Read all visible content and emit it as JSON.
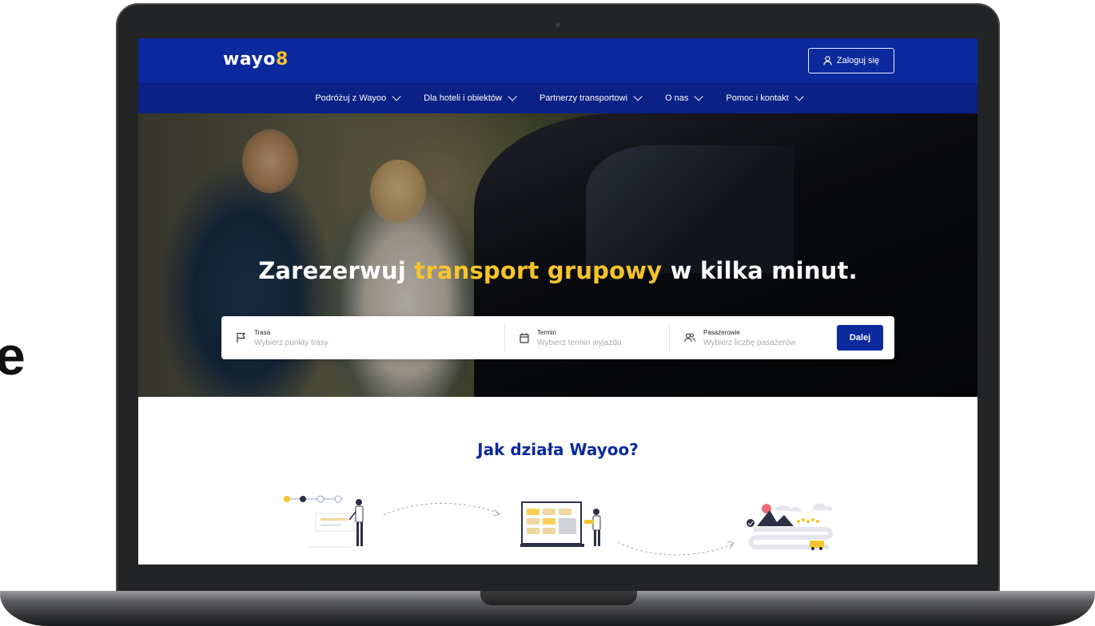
{
  "partial_text": "e",
  "header": {
    "logo_text": "wayo",
    "logo_pin": "8",
    "login_label": "Zaloguj się"
  },
  "nav": {
    "items": [
      {
        "label": "Podróżuj z Wayoo"
      },
      {
        "label": "Dla hoteli i obiektów"
      },
      {
        "label": "Partnerzy transportowi"
      },
      {
        "label": "O nas"
      },
      {
        "label": "Pomoc i kontakt"
      }
    ]
  },
  "hero": {
    "title_before": "Zarezerwuj ",
    "title_accent": "transport grupowy",
    "title_after": " w kilka minut."
  },
  "search": {
    "route_label": "Trasa",
    "route_placeholder": "Wybierz punkty trasy",
    "date_label": "Termin",
    "date_placeholder": "Wybierz termin wyjazdu",
    "passengers_label": "Pasażerowie",
    "passengers_placeholder": "Wybierz liczbę pasażerów",
    "submit_label": "Dalej"
  },
  "how": {
    "title": "Jak działa Wayoo?"
  },
  "colors": {
    "brand_blue": "#0c2a9e",
    "nav_blue": "#0a2186",
    "accent_yellow": "#f7c42b"
  }
}
